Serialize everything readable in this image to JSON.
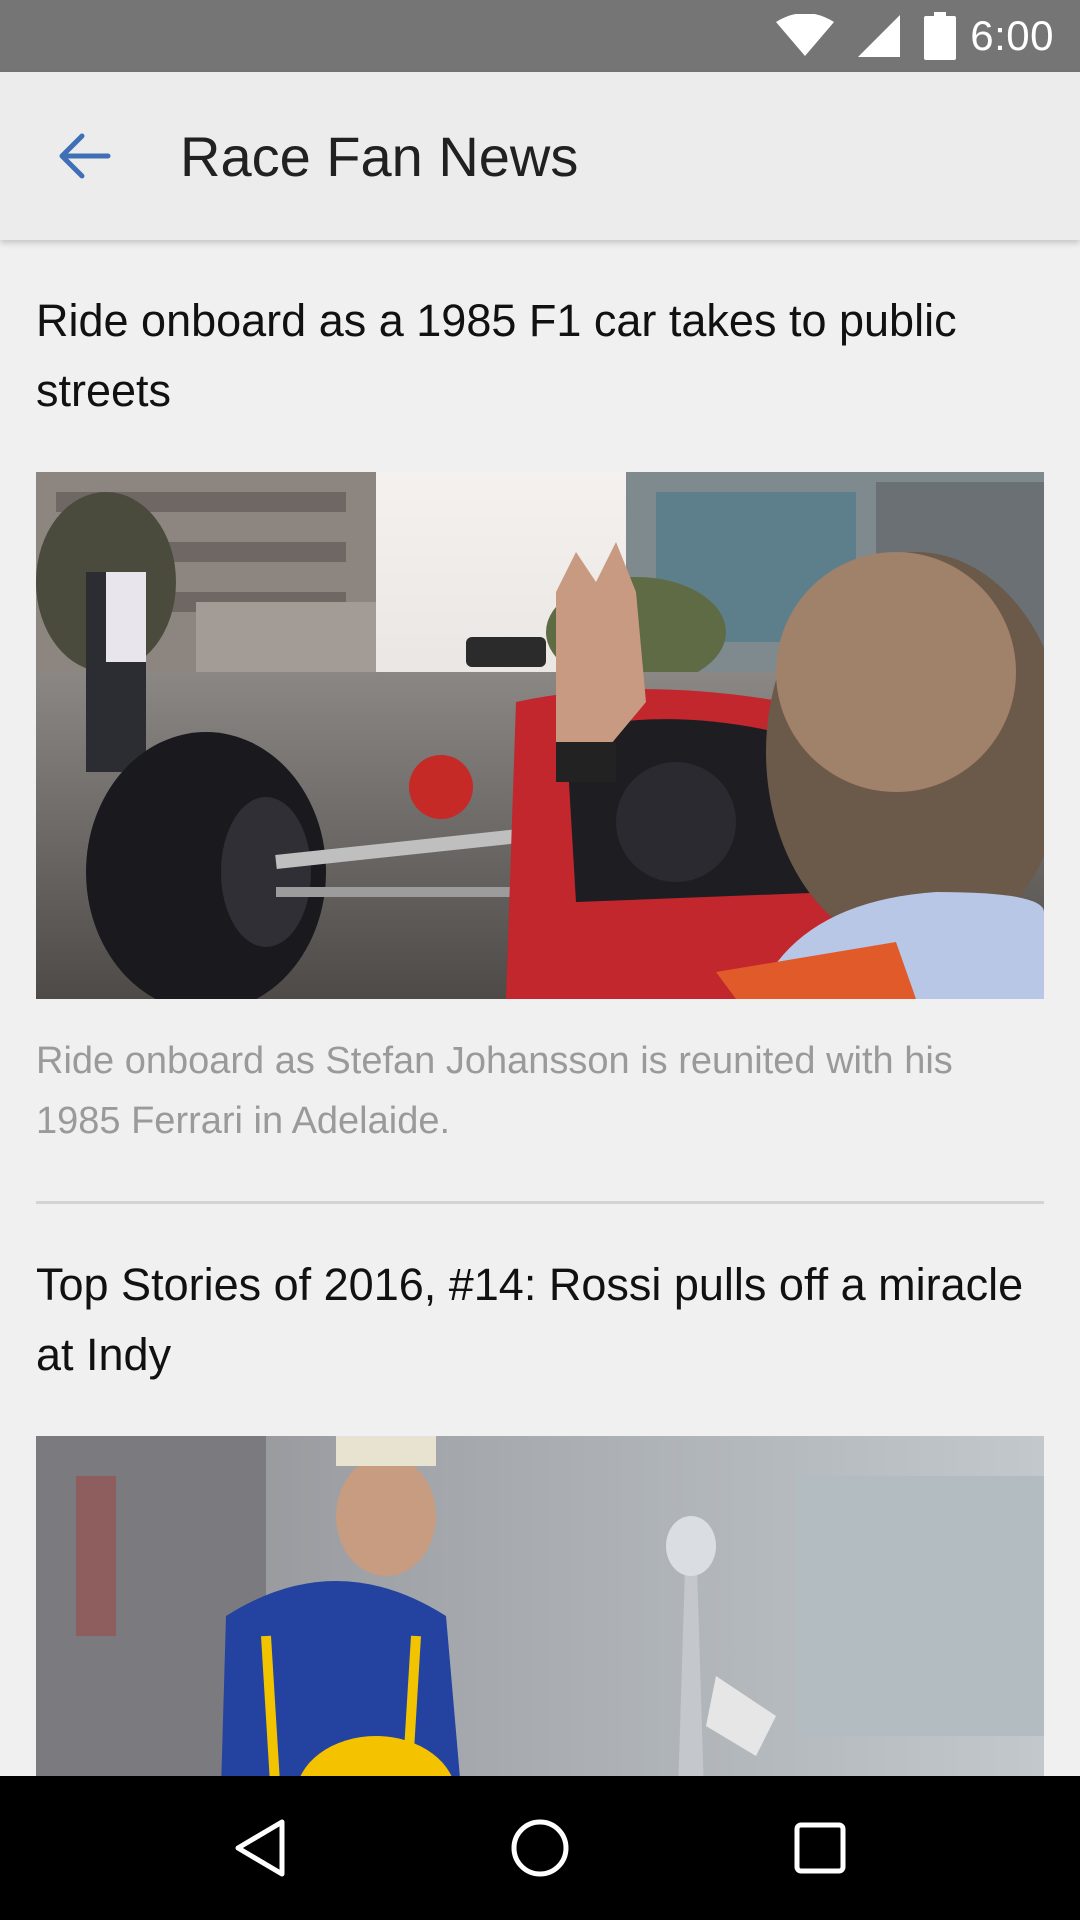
{
  "status_bar": {
    "time": "6:00",
    "icons": [
      "wifi-icon",
      "cell-signal-icon",
      "battery-icon"
    ]
  },
  "app_bar": {
    "title": "Race Fan News",
    "back_icon": "arrow-back-icon",
    "accent_color": "#3f6fb5"
  },
  "articles": [
    {
      "title": "Ride onboard as a 1985 F1 car takes to public streets",
      "summary": "Ride onboard as Stefan Johansson is reunited with his 1985 Ferrari in Adelaide."
    },
    {
      "title": "Top Stories of 2016, #14: Rossi pulls off a miracle at Indy",
      "summary": ""
    }
  ],
  "nav_bar": {
    "icons": [
      "back-triangle-icon",
      "home-circle-icon",
      "recents-square-icon"
    ]
  }
}
